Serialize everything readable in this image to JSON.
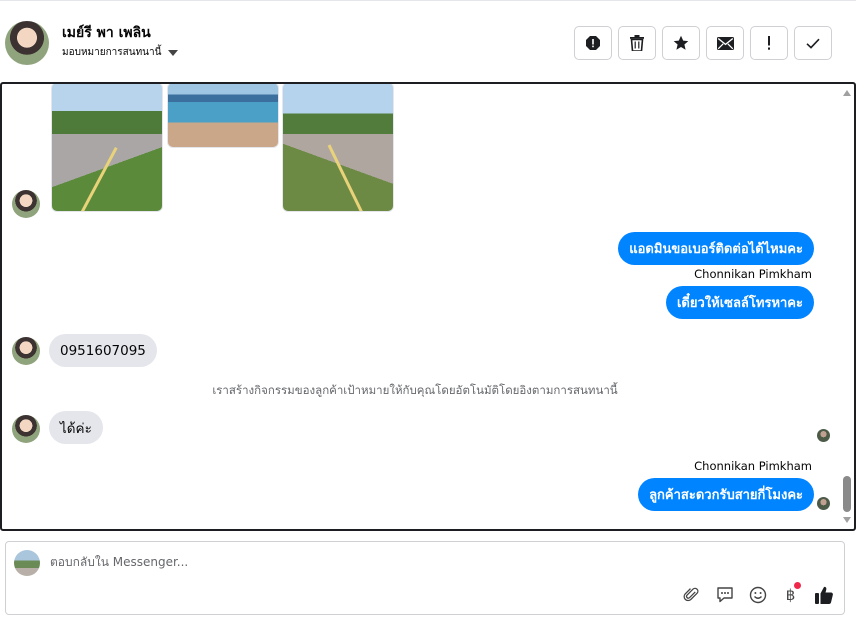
{
  "header": {
    "contact_name": "เมย์รี พา เพลิน",
    "assign_label": "มอบหมายการสนทนานี้",
    "actions": [
      {
        "name": "report-spam-icon",
        "label": "!"
      },
      {
        "name": "trash-icon"
      },
      {
        "name": "star-icon"
      },
      {
        "name": "envelope-icon"
      },
      {
        "name": "exclamation-icon",
        "label": "!"
      },
      {
        "name": "checkmark-icon",
        "label": "✓"
      }
    ]
  },
  "conversation": {
    "photos": [
      "road-photo",
      "shop-photo",
      "road-photo"
    ],
    "messages": {
      "out1": "แอดมินขอเบอร์ติดต่อได้ไหมคะ",
      "sender1": "Chonnikan Pimkham",
      "out2": "เดี๋ยวให้เซลล์โทรหาคะ",
      "in1": "0951607095",
      "system": "เราสร้างกิจกรรมของลูกค้าเป้าหมายให้กับคุณโดยอัตโนมัติโดยอิงตามการสนทนานี้",
      "in2": "ได้ค่ะ",
      "sender2": "Chonnikan Pimkham",
      "out3": "ลูกค้าสะดวกรับสายกี่โมงคะ"
    }
  },
  "composer": {
    "placeholder": "ตอบกลับใน Messenger...",
    "tools": [
      "paperclip-icon",
      "speech-bubble-icon",
      "smiley-icon",
      "baht-icon",
      "thumbs-up-icon"
    ],
    "baht_symbol": "฿"
  },
  "colors": {
    "outgoing_bubble": "#0084ff",
    "incoming_bubble": "#e4e6eb",
    "notification_dot": "#f02849"
  }
}
